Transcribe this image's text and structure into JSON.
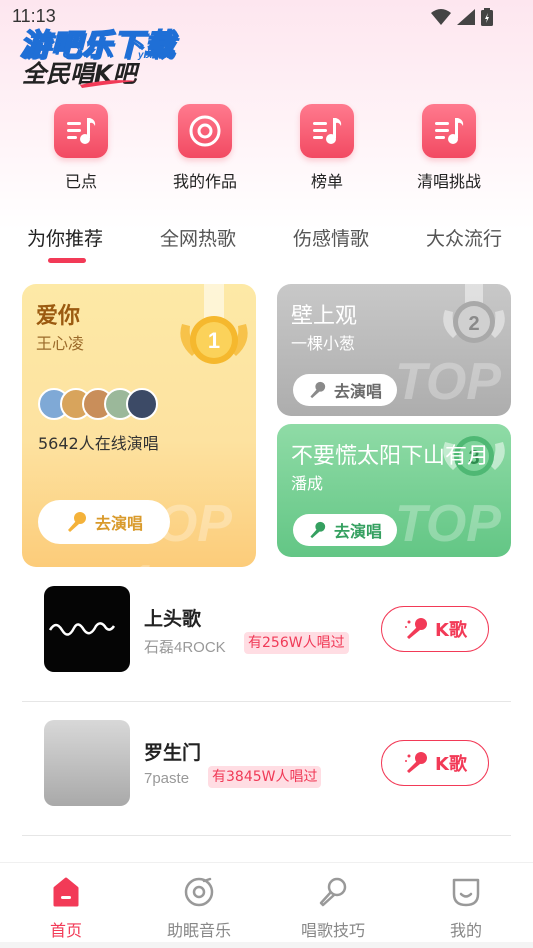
{
  "status_bar": {
    "time": "11:13"
  },
  "watermark": {
    "main": "游吧乐下载",
    "sub": "yb.com"
  },
  "app": {
    "title": "全民唱K吧"
  },
  "quick_actions": [
    {
      "label": "已点",
      "icon": "music-list-icon"
    },
    {
      "label": "我的作品",
      "icon": "record-disc-icon"
    },
    {
      "label": "榜单",
      "icon": "music-list-icon"
    },
    {
      "label": "清唱挑战",
      "icon": "music-list-icon"
    }
  ],
  "tabs": [
    {
      "label": "为你推荐",
      "active": true
    },
    {
      "label": "全网热歌",
      "active": false
    },
    {
      "label": "伤感情歌",
      "active": false
    },
    {
      "label": "大众流行",
      "active": false
    }
  ],
  "top_cards": [
    {
      "rank": "1",
      "title": "爱你",
      "artist": "王心凌",
      "online_text": "5642人在线演唱",
      "button_label": "去演唱",
      "bg_text": "TOP 1"
    },
    {
      "rank": "2",
      "title": "壁上观",
      "artist": "一棵小葱",
      "button_label": "去演唱",
      "bg_text": "TOP 2"
    },
    {
      "rank": "3",
      "title": "不要慌太阳下山有月",
      "artist": "潘成",
      "button_label": "去演唱",
      "bg_text": "TOP 3"
    }
  ],
  "songs": [
    {
      "title": "上头歌",
      "artist": "石磊4ROCK",
      "sang_count": "有256W人唱过",
      "button_label": "K歌"
    },
    {
      "title": "罗生门",
      "artist": "7paste",
      "sang_count": "有3845W人唱过",
      "button_label": "K歌"
    }
  ],
  "bottom_nav": [
    {
      "label": "首页",
      "active": true
    },
    {
      "label": "助眠音乐",
      "active": false
    },
    {
      "label": "唱歌技巧",
      "active": false
    },
    {
      "label": "我的",
      "active": false
    }
  ],
  "colors": {
    "accent": "#f23a57",
    "gold_card": "#fde2a0",
    "silver_card": "#b5b5b5",
    "green_card": "#6fcc8e"
  }
}
